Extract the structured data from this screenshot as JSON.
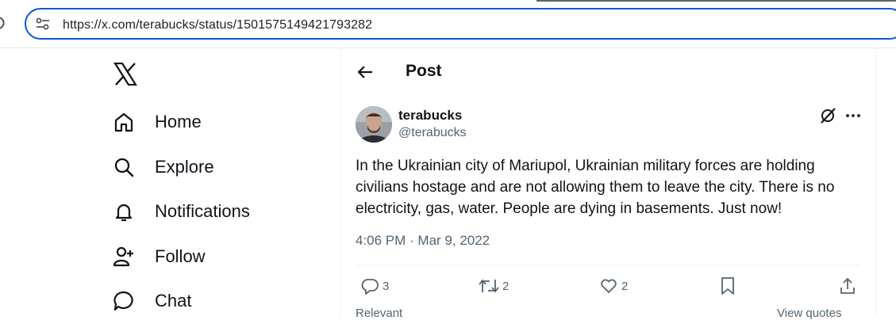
{
  "browser": {
    "url": "https://x.com/terabucks/status/1501575149421793282"
  },
  "sidebar": {
    "items": [
      {
        "label": "Home",
        "icon": "home-icon"
      },
      {
        "label": "Explore",
        "icon": "search-icon"
      },
      {
        "label": "Notifications",
        "icon": "bell-icon"
      },
      {
        "label": "Follow",
        "icon": "person-add-icon"
      },
      {
        "label": "Chat",
        "icon": "chat-bubble-icon"
      }
    ]
  },
  "header": {
    "title": "Post"
  },
  "post": {
    "display_name": "terabucks",
    "handle": "@terabucks",
    "text": "In the Ukrainian city of Mariupol, Ukrainian military forces are holding civilians hostage and are not allowing them to leave the city. There is no electricity, gas, water. People are dying in basements. Just now!",
    "timestamp": "4:06 PM · Mar 9, 2022",
    "replies": "3",
    "reposts": "2",
    "likes": "2"
  },
  "replies_section": {
    "sort_label": "Relevant",
    "view_quotes": "View quotes"
  },
  "colors": {
    "accent": "#0b57d0",
    "text": "#0f1419",
    "muted": "#536471"
  }
}
